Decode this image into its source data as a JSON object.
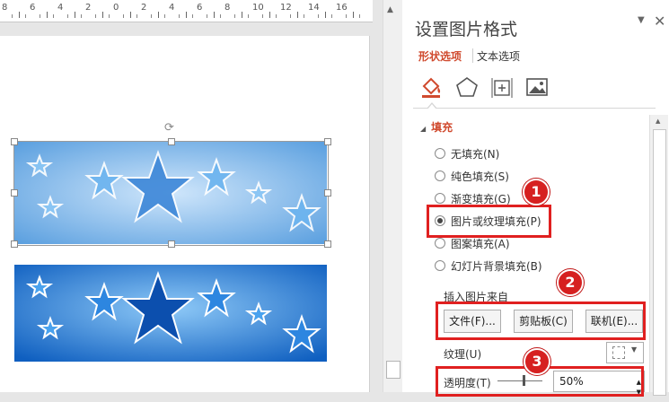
{
  "ruler": {
    "labels": [
      "8",
      "6",
      "4",
      "2",
      "0",
      "2",
      "4",
      "6",
      "8",
      "10",
      "12",
      "14",
      "16"
    ]
  },
  "panel": {
    "title": "设置图片格式",
    "pin_icon": "chevron-down-icon",
    "close_icon": "close-icon",
    "tabs": [
      {
        "label": "形状选项",
        "active": true
      },
      {
        "label": "文本选项",
        "active": false
      }
    ],
    "icons": [
      "fill-line-icon",
      "effects-pentagon-icon",
      "size-properties-icon",
      "picture-icon"
    ],
    "section_title": "填充",
    "fill_options": [
      {
        "label": "无填充(N)",
        "selected": false
      },
      {
        "label": "纯色填充(S)",
        "selected": false
      },
      {
        "label": "渐变填充(G)",
        "selected": false
      },
      {
        "label": "图片或纹理填充(P)",
        "selected": true
      },
      {
        "label": "图案填充(A)",
        "selected": false
      },
      {
        "label": "幻灯片背景填充(B)",
        "selected": false
      }
    ],
    "insert_from_label": "插入图片来自",
    "buttons": {
      "file": "文件(F)...",
      "clipboard": "剪贴板(C)",
      "online": "联机(E)..."
    },
    "texture_label": "纹理(U)",
    "transparency_label": "透明度(T)",
    "transparency_value": "50%"
  },
  "callouts": [
    "1",
    "2",
    "3"
  ],
  "colors": {
    "accent": "#d04a2e",
    "highlight": "#e02020",
    "badge": "#d62020"
  }
}
